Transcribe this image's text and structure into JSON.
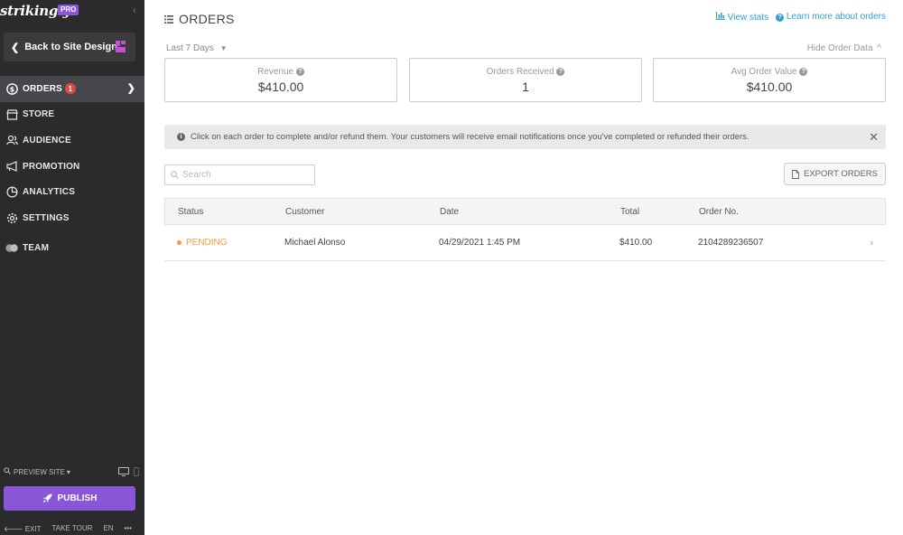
{
  "sidebar": {
    "logo": "strikingly",
    "plan_badge": "PRO",
    "back_label": "Back to Site Design",
    "nav": [
      {
        "label": "ORDERS",
        "icon": "dollar-circle-icon",
        "badge": "1",
        "active": true
      },
      {
        "label": "STORE",
        "icon": "store-icon"
      },
      {
        "label": "AUDIENCE",
        "icon": "audience-icon"
      },
      {
        "label": "PROMOTION",
        "icon": "megaphone-icon"
      },
      {
        "label": "ANALYTICS",
        "icon": "pie-chart-icon"
      },
      {
        "label": "SETTINGS",
        "icon": "gear-icon"
      },
      {
        "label": "TEAM",
        "icon": "team-icon"
      }
    ],
    "preview_label": "PREVIEW SITE",
    "publish_label": "PUBLISH",
    "footer": {
      "exit": "EXIT",
      "tour": "TAKE TOUR",
      "lang": "EN",
      "more": "•••"
    }
  },
  "header": {
    "title": "ORDERS",
    "view_stats": "View stats",
    "learn_more": "Learn more about orders"
  },
  "filters": {
    "range": "Last 7 Days",
    "hide_data": "Hide Order Data"
  },
  "stats": [
    {
      "label": "Revenue",
      "value": "$410.00"
    },
    {
      "label": "Orders Received",
      "value": "1"
    },
    {
      "label": "Avg Order Value",
      "value": "$410.00"
    }
  ],
  "notice": "Click on each order to complete and/or refund them. Your customers will receive email notifications once you've completed or refunded their orders.",
  "search": {
    "placeholder": "Search"
  },
  "export_label": "EXPORT ORDERS",
  "table": {
    "headers": [
      "Status",
      "Customer",
      "Date",
      "Total",
      "Order No."
    ],
    "rows": [
      {
        "status": "PENDING",
        "customer": "Michael Alonso",
        "date": "04/29/2021 1:45 PM",
        "total": "$410.00",
        "order_no": "2104289236507"
      }
    ]
  },
  "colors": {
    "sidebar_bg": "#2b2b2d",
    "accent_purple": "#8a56d8",
    "link_blue": "#2e9fd8",
    "pending_orange": "#f39c3d",
    "badge_red": "#e04848"
  }
}
